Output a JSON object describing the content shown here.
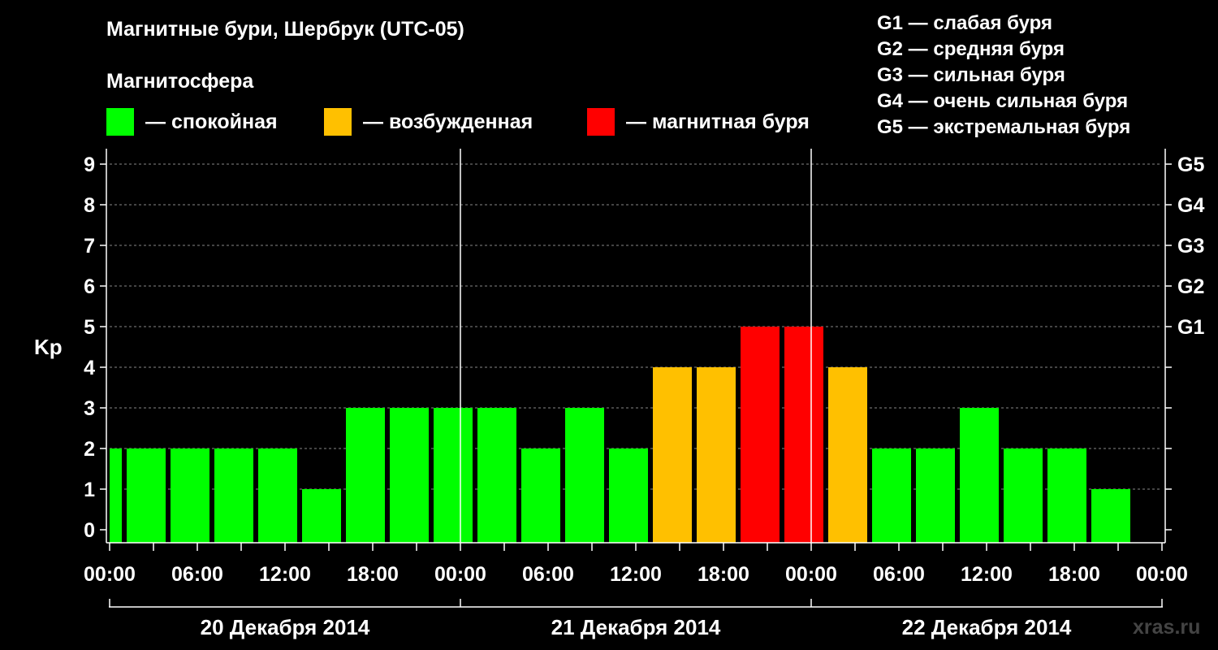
{
  "title": "Магнитные бури, Шербрук (UTC-05)",
  "legend": {
    "heading": "Магнитосфера",
    "items": [
      {
        "label": "— спокойная",
        "color": "#00FF00"
      },
      {
        "label": "— возбужденная",
        "color": "#FFC000"
      },
      {
        "label": "— магнитная буря",
        "color": "#FF0000"
      }
    ]
  },
  "g_levels": [
    "G1 — слабая буря",
    "G2 — средняя буря",
    "G3 — сильная буря",
    "G4 — очень сильная буря",
    "G5 — экстремальная буря"
  ],
  "watermark": "xras.ru",
  "chart_data": {
    "type": "bar",
    "ylabel": "Kp",
    "ylim": [
      0,
      9
    ],
    "yticks": [
      0,
      1,
      2,
      3,
      4,
      5,
      6,
      7,
      8,
      9
    ],
    "right_axis_labels": [
      {
        "value": 5,
        "label": "G1"
      },
      {
        "value": 6,
        "label": "G2"
      },
      {
        "value": 7,
        "label": "G3"
      },
      {
        "value": 8,
        "label": "G4"
      },
      {
        "value": 9,
        "label": "G5"
      }
    ],
    "grid": "horizontal dashed",
    "x_range_hours": [
      0,
      72
    ],
    "xtick_labels": [
      "00:00",
      "06:00",
      "12:00",
      "18:00",
      "00:00",
      "06:00",
      "12:00",
      "18:00",
      "00:00",
      "06:00",
      "12:00",
      "18:00",
      "00:00"
    ],
    "day_labels": [
      "20 Декабря 2014",
      "21 Декабря 2014",
      "22 Декабря 2014"
    ],
    "colors": {
      "quiet": "#00FF00",
      "active": "#FFC000",
      "storm": "#FF0000"
    },
    "bars": [
      {
        "start_hour": 0,
        "end_hour": 1,
        "kp": 2
      },
      {
        "start_hour": 1,
        "end_hour": 4,
        "kp": 2
      },
      {
        "start_hour": 4,
        "end_hour": 7,
        "kp": 2
      },
      {
        "start_hour": 7,
        "end_hour": 10,
        "kp": 2
      },
      {
        "start_hour": 10,
        "end_hour": 13,
        "kp": 2
      },
      {
        "start_hour": 13,
        "end_hour": 16,
        "kp": 1
      },
      {
        "start_hour": 16,
        "end_hour": 19,
        "kp": 3
      },
      {
        "start_hour": 19,
        "end_hour": 22,
        "kp": 3
      },
      {
        "start_hour": 22,
        "end_hour": 25,
        "kp": 3
      },
      {
        "start_hour": 25,
        "end_hour": 28,
        "kp": 3
      },
      {
        "start_hour": 28,
        "end_hour": 31,
        "kp": 2
      },
      {
        "start_hour": 31,
        "end_hour": 34,
        "kp": 3
      },
      {
        "start_hour": 34,
        "end_hour": 37,
        "kp": 2
      },
      {
        "start_hour": 37,
        "end_hour": 40,
        "kp": 4
      },
      {
        "start_hour": 40,
        "end_hour": 43,
        "kp": 4
      },
      {
        "start_hour": 43,
        "end_hour": 46,
        "kp": 5
      },
      {
        "start_hour": 46,
        "end_hour": 49,
        "kp": 5
      },
      {
        "start_hour": 49,
        "end_hour": 52,
        "kp": 4
      },
      {
        "start_hour": 52,
        "end_hour": 55,
        "kp": 2
      },
      {
        "start_hour": 55,
        "end_hour": 58,
        "kp": 2
      },
      {
        "start_hour": 58,
        "end_hour": 61,
        "kp": 3
      },
      {
        "start_hour": 61,
        "end_hour": 64,
        "kp": 2
      },
      {
        "start_hour": 64,
        "end_hour": 67,
        "kp": 2
      },
      {
        "start_hour": 67,
        "end_hour": 70,
        "kp": 1
      }
    ]
  }
}
